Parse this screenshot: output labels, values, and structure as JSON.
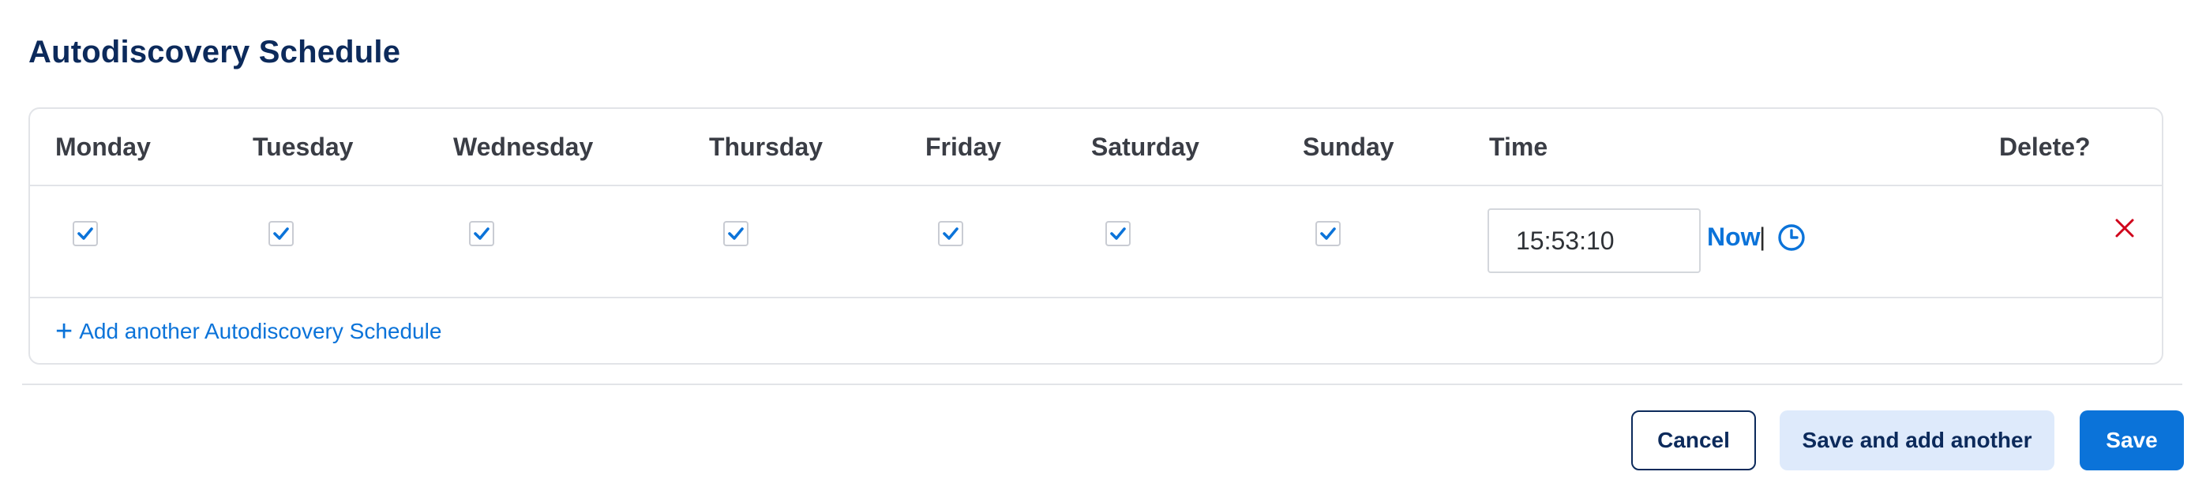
{
  "section": {
    "title": "Autodiscovery Schedule"
  },
  "table": {
    "headers": {
      "monday": "Monday",
      "tuesday": "Tuesday",
      "wednesday": "Wednesday",
      "thursday": "Thursday",
      "friday": "Friday",
      "saturday": "Saturday",
      "sunday": "Sunday",
      "time": "Time",
      "delete": "Delete?"
    },
    "row": {
      "days_checked": [
        true,
        true,
        true,
        true,
        true,
        true,
        true
      ],
      "time_value": "15:53:10",
      "now_label": "Now",
      "separator": "|"
    },
    "add_label": "Add another Autodiscovery Schedule",
    "add_icon": "plus-icon"
  },
  "actions": {
    "cancel_label": "Cancel",
    "save_another_label": "Save and add another",
    "save_label": "Save"
  },
  "colors": {
    "accent": "#0b73d9",
    "title": "#0c2a5b",
    "delete": "#d0021b",
    "secondary_button_bg": "#deeafb"
  },
  "icons": {
    "checkbox": "checkmark-icon",
    "clock": "clock-icon",
    "delete": "close-icon"
  }
}
